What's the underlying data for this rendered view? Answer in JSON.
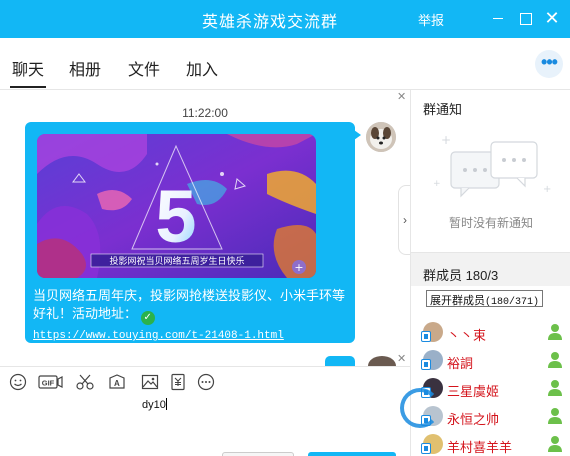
{
  "window": {
    "title": "英雄杀游戏交流群",
    "report_label": "举报",
    "minimize_glyph": "—",
    "maximize_glyph": "□",
    "close_glyph": "✕"
  },
  "tabs": [
    {
      "label": "聊天",
      "active": true
    },
    {
      "label": "相册",
      "active": false
    },
    {
      "label": "文件",
      "active": false
    },
    {
      "label": "加入",
      "active": false
    }
  ],
  "more_label": "•••",
  "chat": {
    "timestamp": "11:22:00",
    "message": {
      "banner_caption": "投影网祝当贝网络五周岁生日快乐",
      "banner_number": "5",
      "text": "当贝网络五周年庆，投影网抢楼送投影仪、小米手环等好礼！活动地址：",
      "link": "https://www.touying.com/t-21408-1.html"
    }
  },
  "toolbar": {
    "items": [
      "smile-icon",
      "gif-icon",
      "scissors-icon",
      "font-icon",
      "image-icon",
      "file-icon",
      "more-icon"
    ],
    "gif_label": "GIF"
  },
  "input": {
    "value": "dy10"
  },
  "right": {
    "notice_title": "群通知",
    "notice_empty": "暂时没有新通知",
    "members_title": "群成员",
    "members_count": "180/3",
    "tooltip_label": "展开群成员",
    "tooltip_count": "(180/371)",
    "members": [
      {
        "name": "丶丶束"
      },
      {
        "name": "裕詷"
      },
      {
        "name": "三星虞姬"
      },
      {
        "name": "永恒之帅"
      },
      {
        "name": "羊村喜羊羊"
      }
    ]
  },
  "colors": {
    "accent": "#12b7f5",
    "member_name": "#d4141c",
    "verified": "#2bb24c"
  }
}
